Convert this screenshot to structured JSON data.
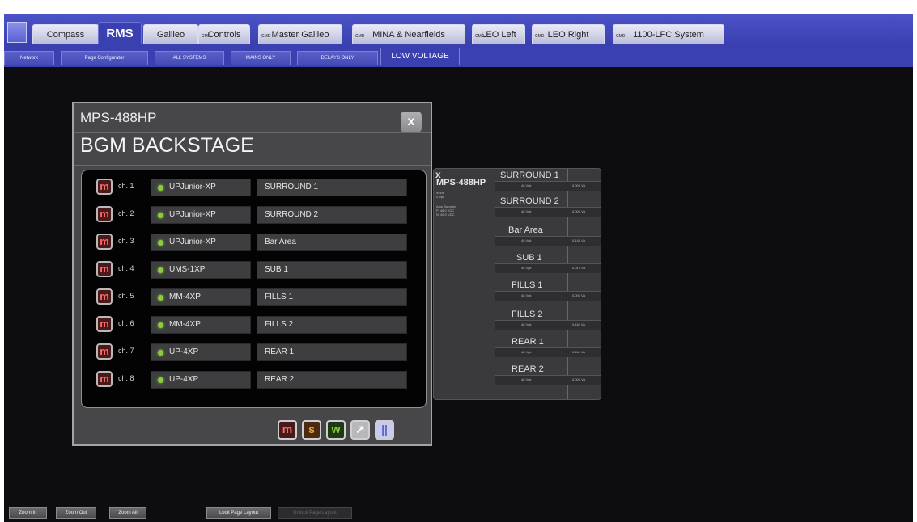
{
  "tabs": [
    {
      "label": "Compass",
      "badge": ""
    },
    {
      "label": "RMS",
      "badge": "",
      "active": true
    },
    {
      "label": "Galileo",
      "badge": ""
    },
    {
      "label": "Controls",
      "badge": "CMD"
    },
    {
      "label": "Master Galileo",
      "badge": "CMD"
    },
    {
      "label": "MINA & Nearfields",
      "badge": "CMD"
    },
    {
      "label": "LEO Left",
      "badge": "CMD"
    },
    {
      "label": "LEO Right",
      "badge": "CMD"
    },
    {
      "label": "1100-LFC System",
      "badge": "CMD"
    }
  ],
  "subtabs": [
    {
      "label": "Network"
    },
    {
      "label": "Page Configurator"
    },
    {
      "label": "ALL SYSTEMS"
    },
    {
      "label": "MAINS ONLY"
    },
    {
      "label": "DELAYS ONLY"
    },
    {
      "label": "LOW VOLTAGE",
      "active": true
    }
  ],
  "dialog": {
    "model": "MPS-488HP",
    "name": "BGM BACKSTAGE",
    "close_label": "x",
    "channels": [
      {
        "ch": "ch. 1",
        "amp": "UPJunior-XP",
        "zone": "SURROUND 1"
      },
      {
        "ch": "ch. 2",
        "amp": "UPJunior-XP",
        "zone": "SURROUND 2"
      },
      {
        "ch": "ch. 3",
        "amp": "UPJunior-XP",
        "zone": "Bar Area"
      },
      {
        "ch": "ch. 4",
        "amp": "UMS-1XP",
        "zone": "SUB 1"
      },
      {
        "ch": "ch. 5",
        "amp": "MM-4XP",
        "zone": "FILLS 1"
      },
      {
        "ch": "ch. 6",
        "amp": "MM-4XP",
        "zone": "FILLS 2"
      },
      {
        "ch": "ch. 7",
        "amp": "UP-4XP",
        "zone": "REAR 1"
      },
      {
        "ch": "ch. 8",
        "amp": "UP-4XP",
        "zone": "REAR 2"
      }
    ],
    "m_label": "m",
    "buttons": {
      "m": "m",
      "s": "s",
      "w": "w",
      "edit": "↗",
      "pause": "||"
    }
  },
  "mini": {
    "close": "x",
    "model": "MPS-488HP",
    "info_lines": [
      "Input",
      "0 Vpk",
      "",
      "Amp Supplied",
      "P: 48.0 VDC",
      "N: 48.0 VDC"
    ],
    "zones": [
      {
        "name": "SURROUND 1",
        "a": "48 Vpk",
        "b": "0.000 VA"
      },
      {
        "name": "SURROUND 2",
        "a": "48 Vpk",
        "b": "0.000 VA"
      },
      {
        "name": "Bar Area",
        "a": "48 Vpk",
        "b": "0.148 VA"
      },
      {
        "name": "SUB 1",
        "a": "48 Vpk",
        "b": "0.010 VA"
      },
      {
        "name": "FILLS 1",
        "a": "48 Vpk",
        "b": "0.000 VA"
      },
      {
        "name": "FILLS 2",
        "a": "48 Vpk",
        "b": "0.110 VA"
      },
      {
        "name": "REAR 1",
        "a": "48 Vpk",
        "b": "0.110 VA"
      },
      {
        "name": "REAR 2",
        "a": "48 Vpk",
        "b": "0.000 VA"
      }
    ]
  },
  "bottom": {
    "zoom_in": "Zoom In",
    "zoom_out": "Zoom Out",
    "zoom_all": "Zoom All",
    "lock": "Lock Page Layout",
    "unlock": "Unlock Page Layout"
  },
  "colors": {
    "accent": "#3a40b0",
    "led": "#8ccc3a",
    "mute": "#ff6a6a"
  }
}
